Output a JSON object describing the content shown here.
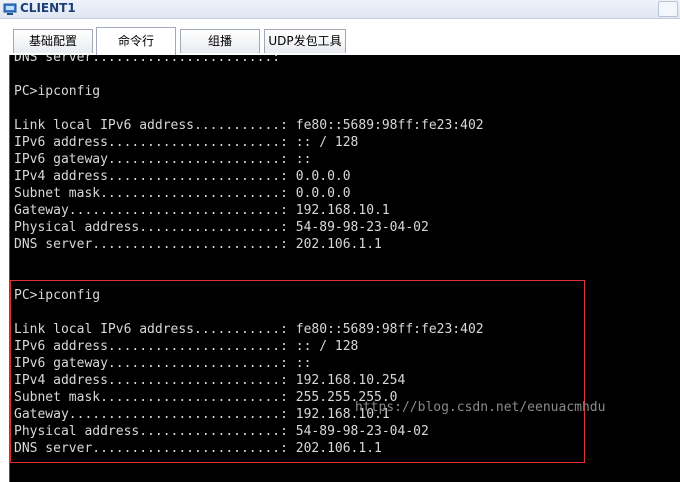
{
  "window": {
    "title": "CLIENT1"
  },
  "tabs": [
    {
      "label": "基础配置"
    },
    {
      "label": "命令行"
    },
    {
      "label": "组播"
    },
    {
      "label": "UDP发包工具"
    }
  ],
  "terminal": {
    "lines": [
      "DNS server.......................:",
      "",
      "PC>ipconfig",
      "",
      "Link local IPv6 address...........: fe80::5689:98ff:fe23:402",
      "IPv6 address......................: :: / 128",
      "IPv6 gateway......................: ::",
      "IPv4 address......................: 0.0.0.0",
      "Subnet mask.......................: 0.0.0.0",
      "Gateway...........................: 192.168.10.1",
      "Physical address..................: 54-89-98-23-04-02",
      "DNS server........................: 202.106.1.1",
      "",
      "",
      "PC>ipconfig",
      "",
      "Link local IPv6 address...........: fe80::5689:98ff:fe23:402",
      "IPv6 address......................: :: / 128",
      "IPv6 gateway......................: ::",
      "IPv4 address......................: 192.168.10.254",
      "Subnet mask.......................: 255.255.255.0",
      "Gateway...........................: 192.168.10.1",
      "Physical address..................: 54-89-98-23-04-02",
      "DNS server........................: 202.106.1.1"
    ],
    "watermark": "https://blog.csdn.net/eenuacmhdu"
  }
}
